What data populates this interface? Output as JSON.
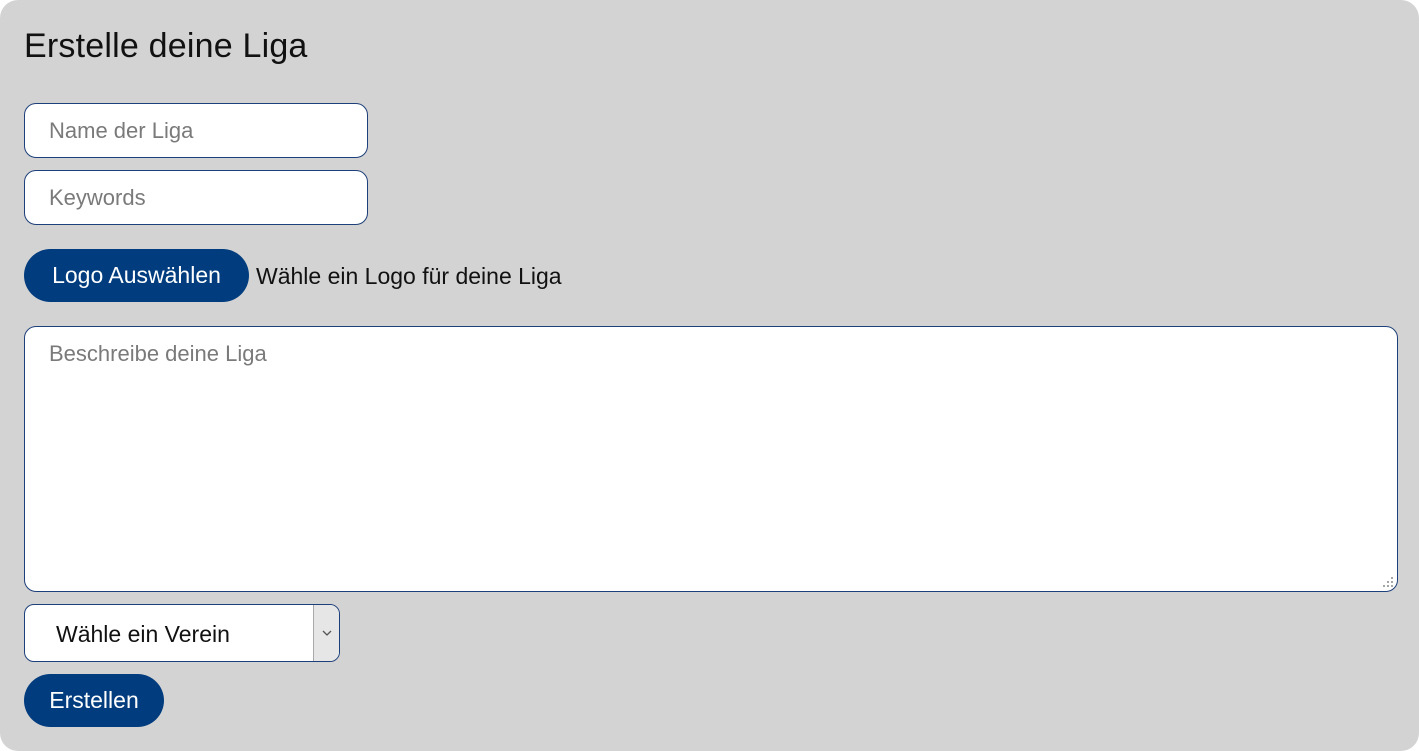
{
  "form": {
    "title": "Erstelle deine Liga",
    "name_placeholder": "Name der Liga",
    "keywords_placeholder": "Keywords",
    "logo_button_label": "Logo Auswählen",
    "logo_hint": "Wähle ein Logo für deine Liga",
    "description_placeholder": "Beschreibe deine Liga",
    "club_select_value": "Wähle ein Verein",
    "submit_label": "Erstellen"
  },
  "colors": {
    "background": "#d3d3d3",
    "accent": "#003c7e",
    "border": "#1d3f7a"
  }
}
